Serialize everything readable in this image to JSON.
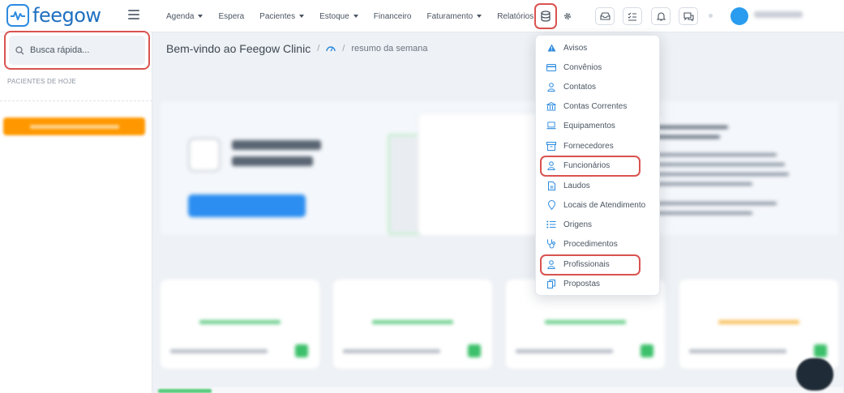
{
  "app": {
    "logo_text": "feegow",
    "accent": "#2c8be0",
    "highlight_color": "#d9534f"
  },
  "nav": {
    "items": [
      {
        "label": "Agenda",
        "has_caret": true
      },
      {
        "label": "Espera",
        "has_caret": false
      },
      {
        "label": "Pacientes",
        "has_caret": true
      },
      {
        "label": "Estoque",
        "has_caret": true
      },
      {
        "label": "Financeiro",
        "has_caret": false
      },
      {
        "label": "Faturamento",
        "has_caret": true
      },
      {
        "label": "Relatórios",
        "has_caret": false
      }
    ],
    "icons": [
      "database-icon",
      "gear-icon",
      "inbox-icon",
      "checklist-icon",
      "bell-icon",
      "chat-icon"
    ]
  },
  "sidebar": {
    "search_placeholder": "Busca rápida...",
    "section_label": "PACIENTES DE HOJE"
  },
  "main": {
    "breadcrumb_title": "Bem-vindo ao Feegow Clinic",
    "breadcrumb_sub": "resumo da semana"
  },
  "dropdown": {
    "items": [
      {
        "label": "Avisos",
        "icon": "warning-icon",
        "highlighted": false
      },
      {
        "label": "Convênios",
        "icon": "card-icon",
        "highlighted": false
      },
      {
        "label": "Contatos",
        "icon": "user-icon",
        "highlighted": false
      },
      {
        "label": "Contas Correntes",
        "icon": "bank-icon",
        "highlighted": false
      },
      {
        "label": "Equipamentos",
        "icon": "laptop-icon",
        "highlighted": false
      },
      {
        "label": "Fornecedores",
        "icon": "box-icon",
        "highlighted": false
      },
      {
        "label": "Funcionários",
        "icon": "user-icon",
        "highlighted": true
      },
      {
        "label": "Laudos",
        "icon": "document-icon",
        "highlighted": false
      },
      {
        "label": "Locais de Atendimento",
        "icon": "location-pin-icon",
        "highlighted": false
      },
      {
        "label": "Origens",
        "icon": "list-icon",
        "highlighted": false
      },
      {
        "label": "Procedimentos",
        "icon": "stethoscope-icon",
        "highlighted": false
      },
      {
        "label": "Profissionais",
        "icon": "user-icon",
        "highlighted": true
      },
      {
        "label": "Propostas",
        "icon": "copy-icon",
        "highlighted": false
      }
    ]
  }
}
